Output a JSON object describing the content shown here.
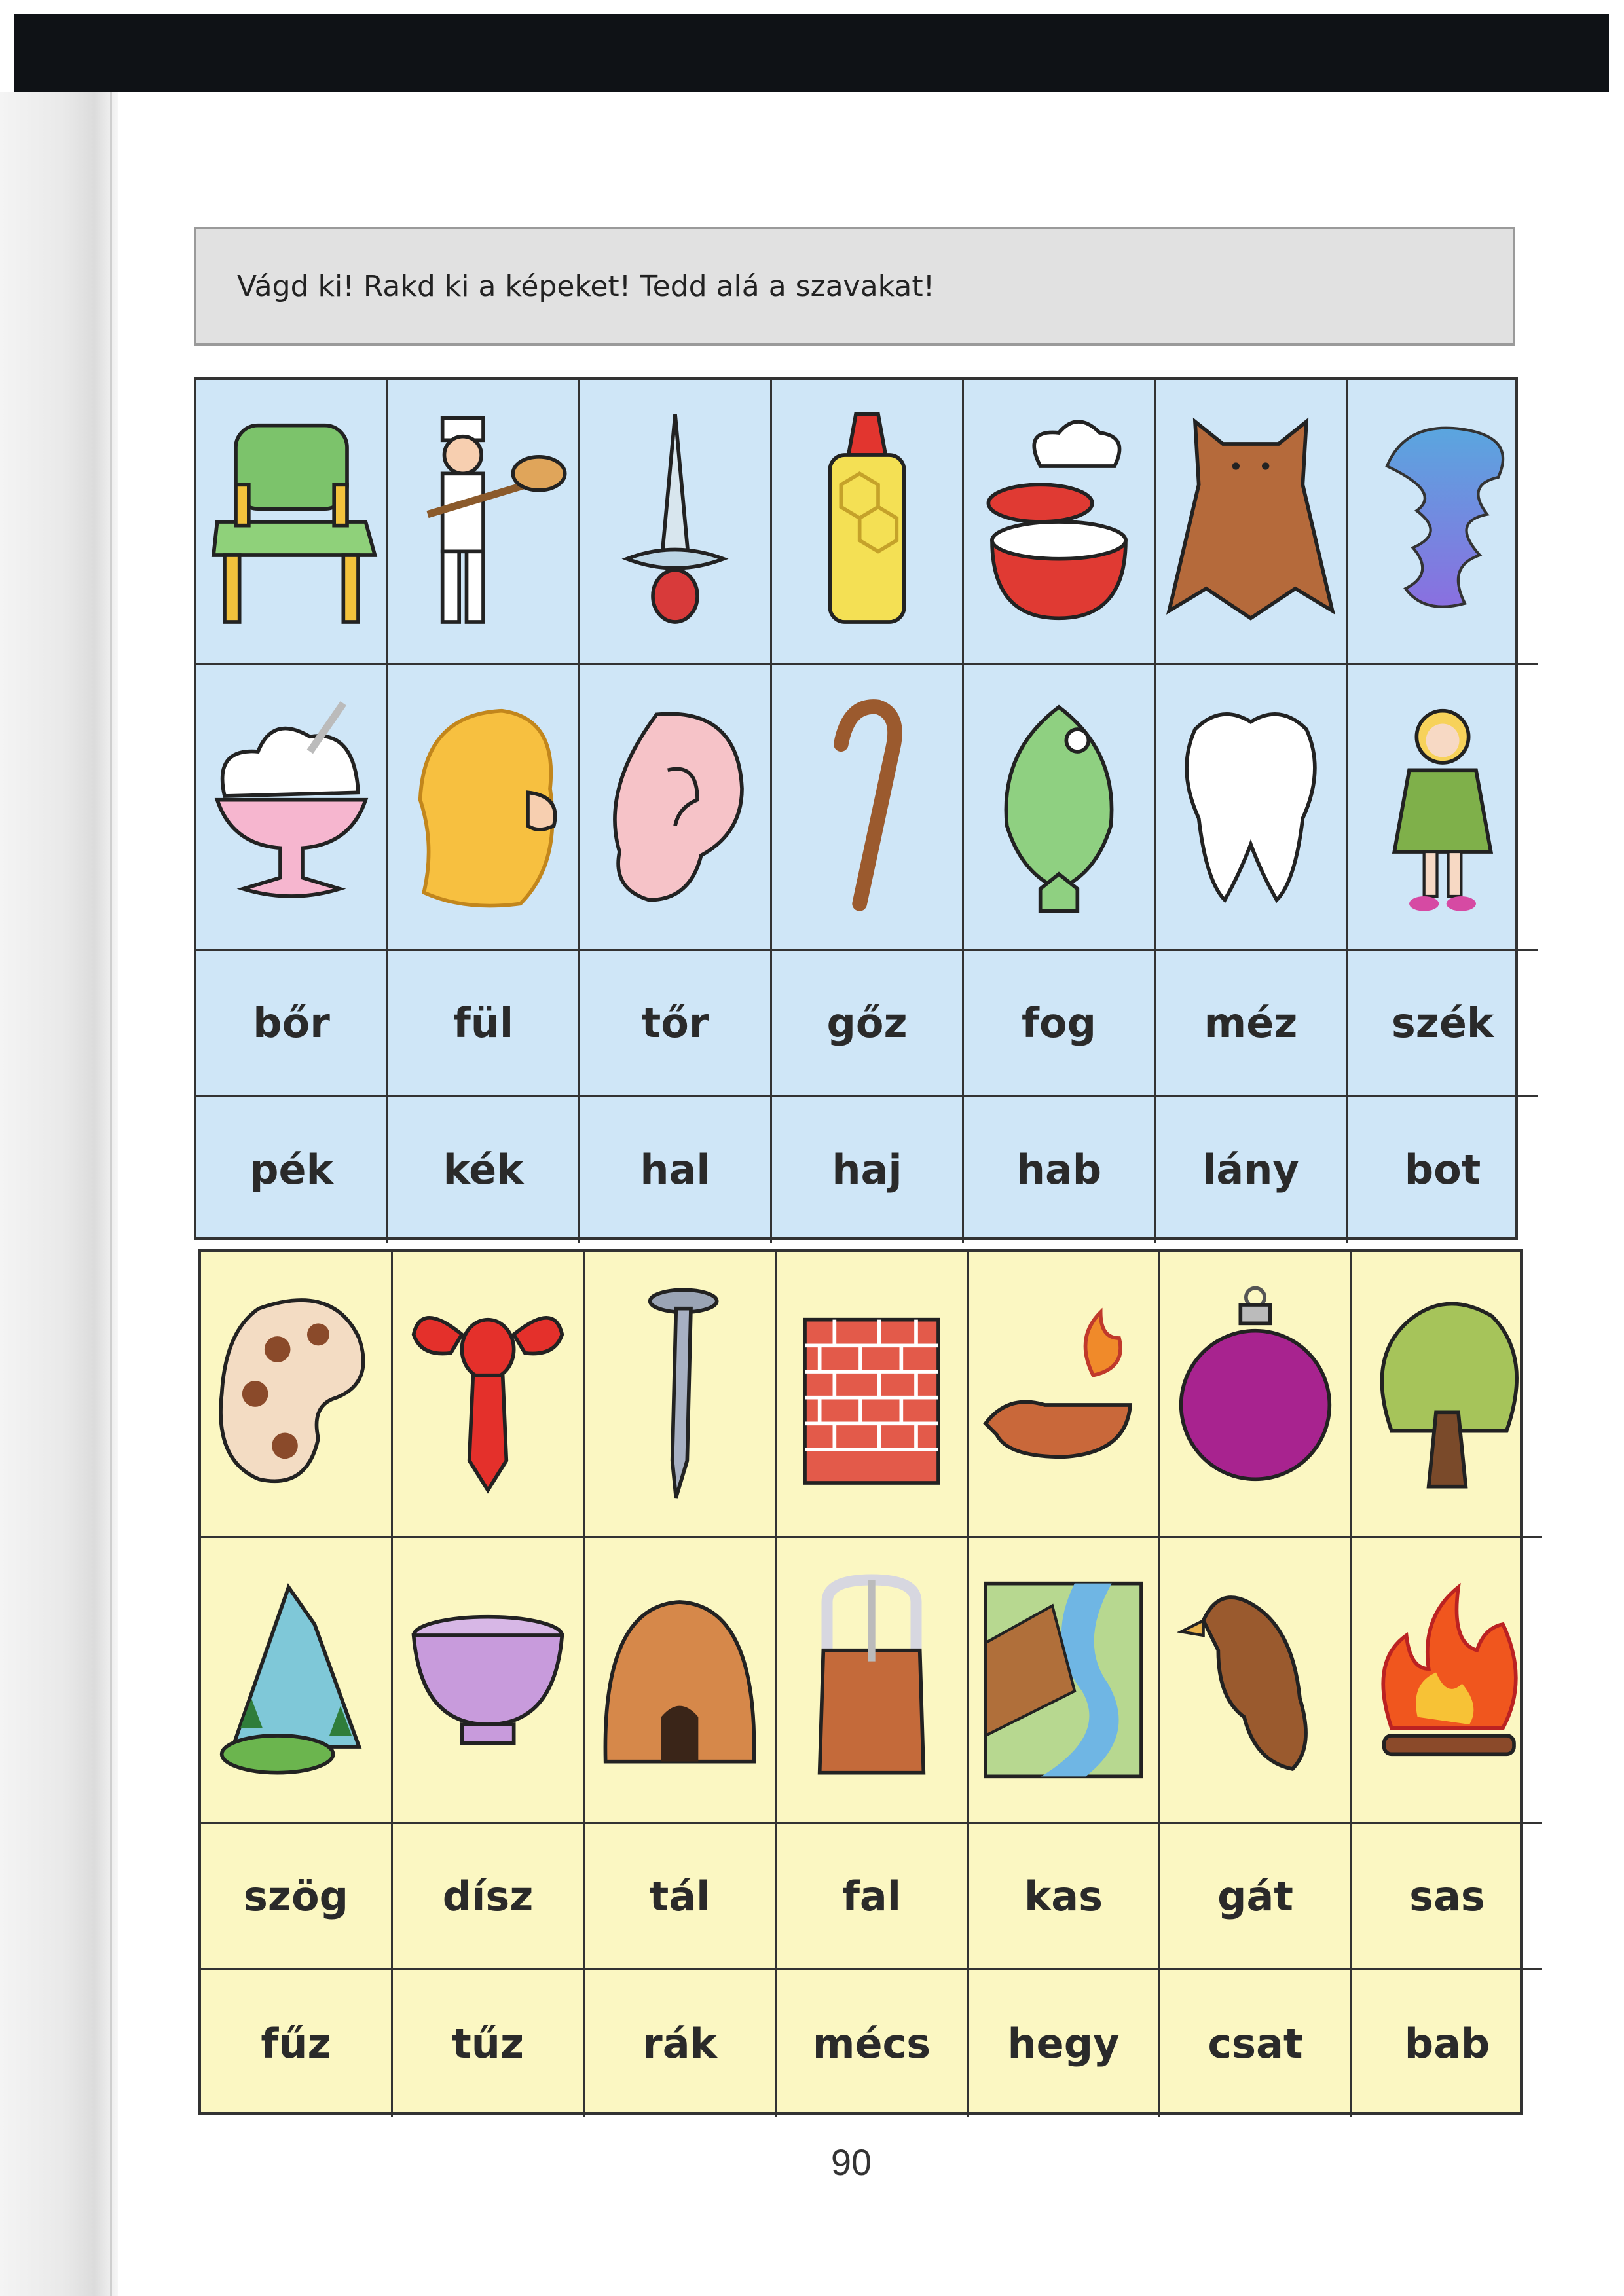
{
  "instruction": "Vágd ki! Rakd ki a képeket! Tedd alá a szavakat!",
  "blue_sheet": {
    "pictures_row1": [
      "chair-icon",
      "baker-icon",
      "dagger-icon",
      "glue-bottle-icon",
      "steaming-pot-icon",
      "bear-skin-icon",
      "steam-cloud-icon"
    ],
    "pictures_row2": [
      "whipped-cream-icon",
      "blonde-hair-icon",
      "ear-icon",
      "walking-stick-icon",
      "fish-icon",
      "tooth-icon",
      "girl-doll-icon"
    ],
    "words_row1": [
      "bőr",
      "fül",
      "tőr",
      "gőz",
      "fog",
      "méz",
      "szék"
    ],
    "words_row2": [
      "pék",
      "kék",
      "hal",
      "haj",
      "hab",
      "lány",
      "bot"
    ]
  },
  "yellow_sheet": {
    "pictures_row1": [
      "bean-icon",
      "crayfish-icon",
      "nail-icon",
      "brick-wall-icon",
      "oil-lamp-icon",
      "christmas-ornament-icon",
      "willow-tree-icon"
    ],
    "pictures_row2": [
      "mountain-icon",
      "bowl-icon",
      "beehive-icon",
      "buckle-icon",
      "river-dam-icon",
      "eagle-icon",
      "campfire-icon"
    ],
    "words_row1": [
      "szög",
      "dísz",
      "tál",
      "fal",
      "kas",
      "gát",
      "sas"
    ],
    "words_row2": [
      "fűz",
      "tűz",
      "rák",
      "mécs",
      "hegy",
      "csat",
      "bab"
    ]
  },
  "page_number": "90",
  "colors": {
    "blue_bg": "#cfe6f7",
    "yellow_bg": "#fbf7c2",
    "grid_line": "#333333",
    "instruction_bg": "#e1e1e1"
  }
}
